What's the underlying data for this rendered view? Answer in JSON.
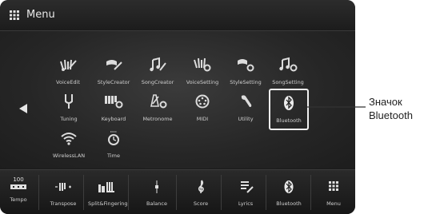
{
  "header": {
    "title": "Menu"
  },
  "menu_rows": [
    [
      {
        "label": "VoiceEdit",
        "icon": "voice-edit-icon"
      },
      {
        "label": "StyleCreator",
        "icon": "style-creator-icon"
      },
      {
        "label": "SongCreator",
        "icon": "song-creator-icon"
      },
      {
        "label": "VoiceSetting",
        "icon": "voice-setting-icon"
      },
      {
        "label": "StyleSetting",
        "icon": "style-setting-icon"
      },
      {
        "label": "SongSetting",
        "icon": "song-setting-icon"
      }
    ],
    [
      {
        "label": "Tuning",
        "icon": "tuning-fork-icon"
      },
      {
        "label": "Keyboard",
        "icon": "keyboard-setting-icon"
      },
      {
        "label": "Metronome",
        "icon": "metronome-setting-icon"
      },
      {
        "label": "MIDI",
        "icon": "midi-icon"
      },
      {
        "label": "Utility",
        "icon": "wrench-icon"
      },
      {
        "label": "Bluetooth",
        "icon": "bluetooth-icon"
      }
    ],
    [
      {
        "label": "WirelessLAN",
        "icon": "wifi-icon"
      },
      {
        "label": "Time",
        "icon": "clock-icon"
      }
    ]
  ],
  "bottom_bar": {
    "tempo_value": "100",
    "items": [
      {
        "label": "Tempo"
      },
      {
        "label": "Transpose"
      },
      {
        "label": "Split&Fingering"
      },
      {
        "label": "Balance"
      },
      {
        "label": "Score"
      },
      {
        "label": "Lyrics"
      },
      {
        "label": "Bluetooth"
      },
      {
        "label": "Menu"
      }
    ]
  },
  "callout": {
    "line1": "Значок",
    "line2": "Bluetooth"
  }
}
